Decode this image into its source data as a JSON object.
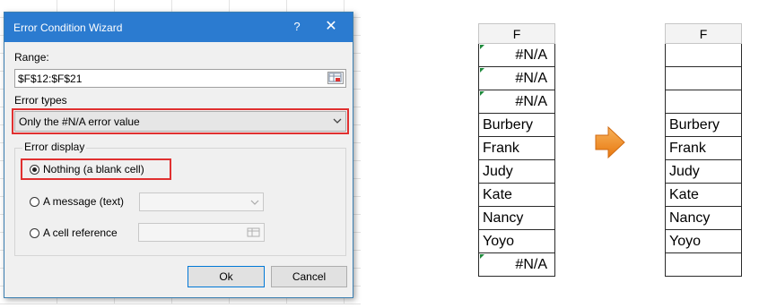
{
  "dialog": {
    "title": "Error Condition Wizard",
    "help": "?",
    "close": "✕",
    "range_label": "Range:",
    "range_value": "$F$12:$F$21",
    "error_types_label": "Error types",
    "error_type_selected": "Only the #N/A error value",
    "error_display_label": "Error display",
    "options": [
      {
        "label": "Nothing (a blank cell)",
        "selected": true
      },
      {
        "label": "A message (text)",
        "selected": false
      },
      {
        "label": "A cell reference",
        "selected": false
      }
    ],
    "ok": "Ok",
    "cancel": "Cancel"
  },
  "before": {
    "header": "F",
    "cells": [
      "#N/A",
      "#N/A",
      "#N/A",
      "Burbery",
      "Frank",
      "Judy",
      "Kate",
      "Nancy",
      "Yoyo",
      "#N/A"
    ]
  },
  "after": {
    "header": "F",
    "cells": [
      "",
      "",
      "",
      "Burbery",
      "Frank",
      "Judy",
      "Kate",
      "Nancy",
      "Yoyo",
      ""
    ]
  },
  "colors": {
    "titlebar": "#2b7bd0",
    "highlight": "#e03030",
    "arrow": "#f08a1c"
  }
}
